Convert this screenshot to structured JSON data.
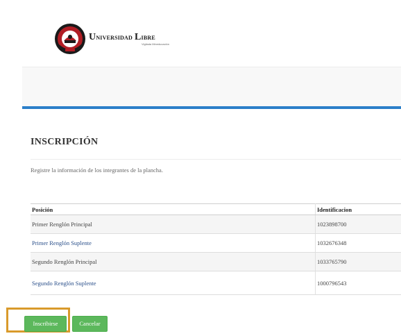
{
  "brand": {
    "name_first_initial": "U",
    "name_first_rest": "niversidad",
    "name_second_initial": "L",
    "name_second_rest": "ibre",
    "tagline": "Vigilada Mineducación",
    "seal_text_top": "UNIVERSIDAD LIBRE",
    "seal_text_bottom": "COLOMBIA",
    "colors": {
      "seal_red": "#b11e25",
      "seal_dark": "#1a1a1a"
    }
  },
  "page": {
    "title": "INSCRIPCIÓN",
    "description": "Registre la información de los integrantes de la plancha."
  },
  "table": {
    "headers": [
      "Posición",
      "Identificacion"
    ],
    "rows": [
      {
        "position": "Primer Renglón Principal",
        "id": "1023898700"
      },
      {
        "position": "Primer Renglón Suplente",
        "id": "1032676348"
      },
      {
        "position": "Segundo Renglón Principal",
        "id": "1033765790"
      },
      {
        "position": "Segundo Renglón Suplente",
        "id": "1000796543"
      }
    ]
  },
  "actions": {
    "submit_label": "Inscribirse",
    "cancel_label": "Cancelar"
  },
  "colors": {
    "accent_blue": "#2c7fc9",
    "button_green": "#5cb85c",
    "highlight_orange": "#d99a2b"
  }
}
